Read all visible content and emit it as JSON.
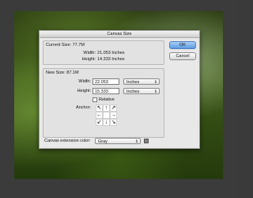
{
  "dialog": {
    "title": "Canvas Size",
    "ok_label": "OK",
    "cancel_label": "Cancel"
  },
  "current_size": {
    "header": "Current Size: 77.7M",
    "width_label": "Width:",
    "width_value": "21.053 Inches",
    "height_label": "Height:",
    "height_value": "14.333 Inches"
  },
  "new_size": {
    "header": "New Size: 87.1M",
    "width_label": "Width:",
    "width_value": "22.053",
    "width_unit": "Inches",
    "height_label": "Height:",
    "height_value": "15.333",
    "height_unit": "Inches",
    "relative_label": "Relative",
    "relative_checked": false,
    "anchor_label": "Anchor:"
  },
  "extension": {
    "label": "Canvas extension color:",
    "value": "Gray",
    "swatch_color": "#808080"
  },
  "anchor_arrows": [
    "↖",
    "↑",
    "↗",
    "←",
    "",
    "→",
    "↙",
    "↓",
    "↘"
  ],
  "icons": {
    "dropdown": "chevron-up-down-icon"
  }
}
